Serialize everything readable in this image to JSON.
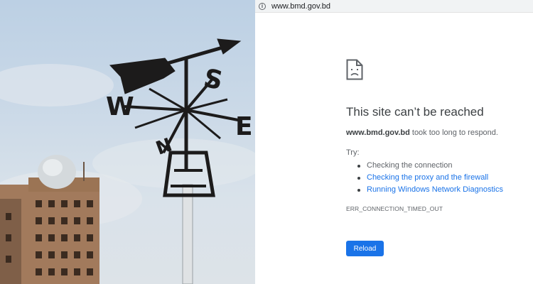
{
  "browser": {
    "url": "www.bmd.gov.bd",
    "info_icon_glyph": "i"
  },
  "error_page": {
    "icon": "sad-page-icon",
    "title": "This site can’t be reached",
    "detail_host": "www.bmd.gov.bd",
    "detail_text": " took too long to respond.",
    "try_label": "Try:",
    "suggestions": [
      {
        "label": "Checking the connection",
        "is_link": false
      },
      {
        "label": "Checking the proxy and the firewall",
        "is_link": true
      },
      {
        "label": "Running Windows Network Diagnostics",
        "is_link": true
      }
    ],
    "error_code": "ERR_CONNECTION_TIMED_OUT",
    "reload_label": "Reload"
  },
  "photo": {
    "wind_vane_letters": [
      "W",
      "S",
      "E",
      "N"
    ]
  },
  "colors": {
    "link": "#1a73e8",
    "button": "#1a73e8",
    "title": "#3c4043",
    "body_text": "#5f6368",
    "address_bar": "#f1f3f4"
  }
}
